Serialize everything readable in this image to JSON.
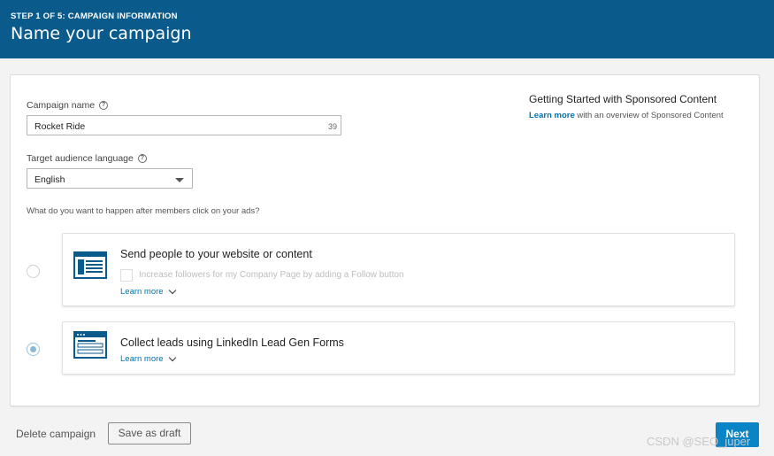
{
  "header": {
    "step": "STEP 1 OF 5: CAMPAIGN INFORMATION",
    "title": "Name your campaign"
  },
  "form": {
    "campaign_name_label": "Campaign name",
    "campaign_name_value": "Rocket Ride",
    "campaign_name_remaining": "39",
    "language_label": "Target audience language",
    "language_value": "English",
    "question": "What do you want to happen after members click on your ads?"
  },
  "options": [
    {
      "title": "Send people to your website or content",
      "checkbox_label": "Increase followers for my Company Page by adding a Follow button",
      "learn_more": "Learn more",
      "selected": false
    },
    {
      "title": "Collect leads using LinkedIn Lead Gen Forms",
      "learn_more": "Learn more",
      "selected": true
    }
  ],
  "sidebar": {
    "title": "Getting Started with Sponsored Content",
    "link": "Learn more",
    "desc": " with an overview of Sponsored Content"
  },
  "footer": {
    "delete": "Delete campaign",
    "draft": "Save as draft",
    "next": "Next"
  },
  "watermark": "CSDN @SEO_juper",
  "colors": {
    "header_bg": "#0b5a8c",
    "link": "#0073b1",
    "primary_button": "#0b84c6"
  },
  "icons": [
    "help-icon",
    "dropdown-caret-icon",
    "website-content-icon",
    "lead-gen-form-icon",
    "chevron-down-icon"
  ]
}
